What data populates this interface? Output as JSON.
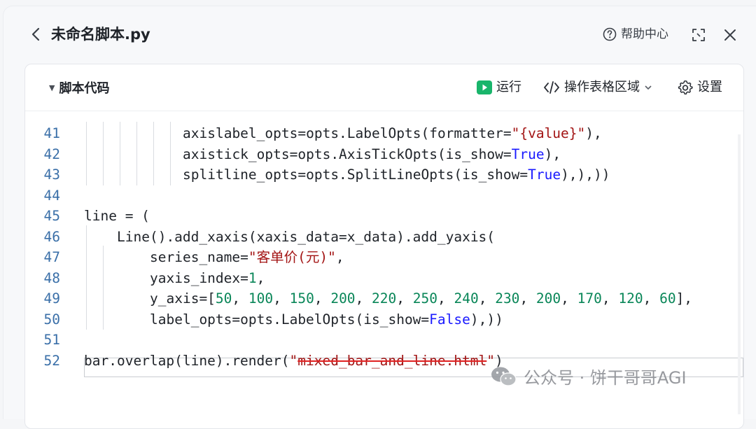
{
  "window": {
    "title": "未命名脚本.py"
  },
  "header": {
    "help_label": "帮助中心"
  },
  "card": {
    "section_title": "脚本代码",
    "run_label": "运行",
    "operate_label": "操作表格区域",
    "settings_label": "设置"
  },
  "code": {
    "lines": [
      {
        "num": "41",
        "indent": 6,
        "text": "axislabel_opts=opts.LabelOpts(formatter=\"{value}\"),"
      },
      {
        "num": "42",
        "indent": 6,
        "text": "axistick_opts=opts.AxisTickOpts(is_show=True),"
      },
      {
        "num": "43",
        "indent": 6,
        "text": "splitline_opts=opts.SplitLineOpts(is_show=True),),))"
      },
      {
        "num": "44",
        "indent": 0,
        "text": ""
      },
      {
        "num": "45",
        "indent": 0,
        "text": "line = ("
      },
      {
        "num": "46",
        "indent": 1,
        "text": "Line().add_xaxis(xaxis_data=x_data).add_yaxis("
      },
      {
        "num": "47",
        "indent": 2,
        "text": "series_name=\"客单价(元)\","
      },
      {
        "num": "48",
        "indent": 2,
        "text": "yaxis_index=1,"
      },
      {
        "num": "49",
        "indent": 2,
        "text": "y_axis=[50, 100, 150, 200, 220, 250, 240, 230, 200, 170, 120, 60],"
      },
      {
        "num": "50",
        "indent": 2,
        "text": "label_opts=opts.LabelOpts(is_show=False),))"
      },
      {
        "num": "51",
        "indent": 0,
        "text": ""
      },
      {
        "num": "52",
        "indent": 0,
        "text": "bar.overlap(line).render(\"mixed_bar_and_line.html\")"
      }
    ]
  },
  "watermark": {
    "text": "公众号 · 饼干哥哥AGI"
  },
  "colors": {
    "keyword": "#1a1aff",
    "string": "#a31515",
    "number": "#098658",
    "line_number": "#3a6fa8",
    "run_icon": "#19b56b"
  }
}
